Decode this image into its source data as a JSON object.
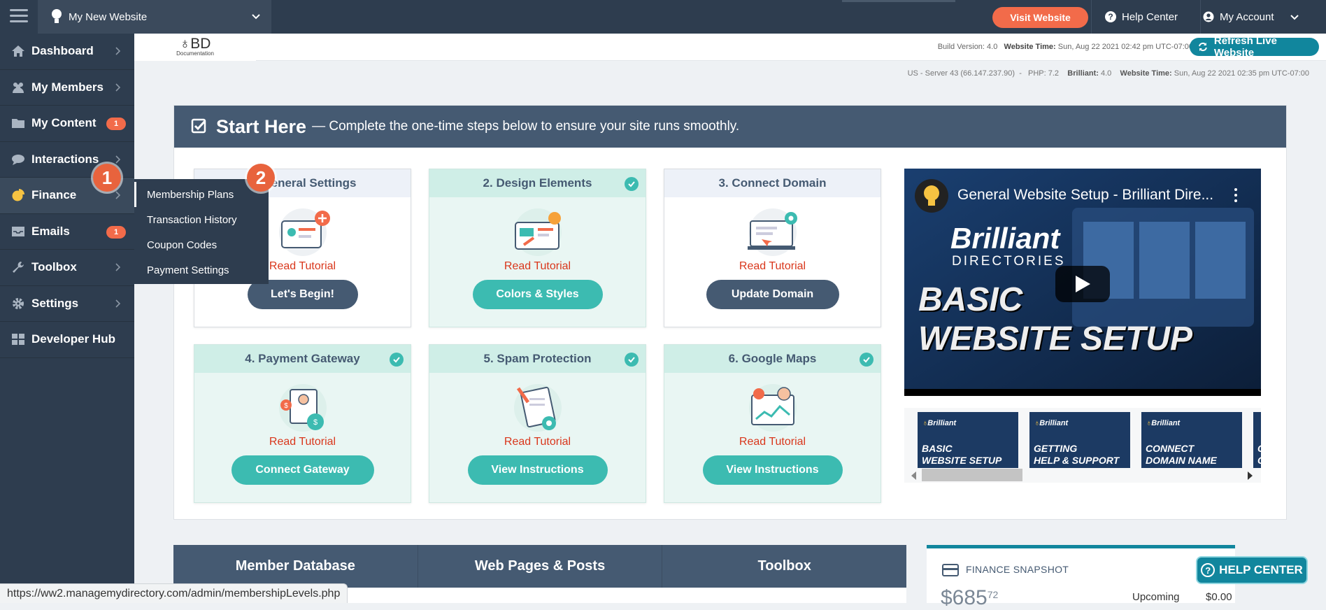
{
  "topbar": {
    "site_name": "My New Website",
    "visit_button": "Visit Website",
    "help_center": "Help Center",
    "my_account": "My Account"
  },
  "sidebar": {
    "items": [
      {
        "label": "Dashboard",
        "icon": "home-icon"
      },
      {
        "label": "My Members",
        "icon": "users-icon"
      },
      {
        "label": "My Content",
        "icon": "folder-icon",
        "badge": "1"
      },
      {
        "label": "Interactions",
        "icon": "chat-icon"
      },
      {
        "label": "Finance",
        "icon": "pie-chart-icon"
      },
      {
        "label": "Emails",
        "icon": "inbox-icon",
        "badge": "1"
      },
      {
        "label": "Toolbox",
        "icon": "wrench-icon"
      },
      {
        "label": "Settings",
        "icon": "gear-icon"
      },
      {
        "label": "Developer Hub",
        "icon": "grid-icon"
      }
    ]
  },
  "flyout": {
    "items": [
      "Membership Plans",
      "Transaction History",
      "Coupon Codes",
      "Payment Settings"
    ]
  },
  "annotations": {
    "step1": "1",
    "step2": "2"
  },
  "logo": {
    "mark": "BD",
    "sub": "Documentation"
  },
  "infobar": {
    "build_label": "Build Version:",
    "build_value": "4.0",
    "time_label": "Website Time:",
    "time_value": "Sun, Aug 22 2021 02:42 pm UTC-07:00",
    "refresh_button": "Refresh Live Website"
  },
  "server": {
    "server_value": "US - Server 43 (66.147.237.90)",
    "php": "PHP: 7.2",
    "brilliant_label": "Brilliant:",
    "brilliant_value": "4.0",
    "time_label": "Website Time:",
    "time_value": "Sun, Aug 22 2021 02:35 pm UTC-07:00"
  },
  "start": {
    "title": "Start Here",
    "subtitle": "— Complete the one-time steps below to ensure your site runs smoothly.",
    "cards": [
      {
        "title": "1. General Settings",
        "tutorial": "Read Tutorial",
        "button": "Let's Begin!",
        "done": false
      },
      {
        "title": "2. Design Elements",
        "tutorial": "Read Tutorial",
        "button": "Colors & Styles",
        "done": true
      },
      {
        "title": "3. Connect Domain",
        "tutorial": "Read Tutorial",
        "button": "Update Domain",
        "done": false
      },
      {
        "title": "4. Payment Gateway",
        "tutorial": "Read Tutorial",
        "button": "Connect Gateway",
        "done": true
      },
      {
        "title": "5. Spam Protection",
        "tutorial": "Read Tutorial",
        "button": "View Instructions",
        "done": true
      },
      {
        "title": "6. Google Maps",
        "tutorial": "Read Tutorial",
        "button": "View Instructions",
        "done": true
      }
    ]
  },
  "video": {
    "title": "General Website Setup - Brilliant Dire...",
    "brand": "Brilliant",
    "brand_sub": "DIRECTORIES",
    "headline_1": "BASIC",
    "headline_2": "WEBSITE SETUP",
    "thumbnails": [
      {
        "line1": "BASIC",
        "line2": "WEBSITE SETUP"
      },
      {
        "line1": "GETTING",
        "line2": "HELP & SUPPORT"
      },
      {
        "line1": "CONNECT",
        "line2": "DOMAIN NAME"
      },
      {
        "line1": "C",
        "line2": "C"
      }
    ]
  },
  "bottom_tabs": [
    "Member Database",
    "Web Pages & Posts",
    "Toolbox"
  ],
  "finance": {
    "title": "FINANCE SNAPSHOT",
    "amount_whole": "$685",
    "amount_cents": "72",
    "upcoming_label": "Upcoming",
    "upcoming_value": "$0.00"
  },
  "help_button": "HELP CENTER",
  "status_url": "https://ww2.managemydirectory.com/admin/membershipLevels.php",
  "colors": {
    "sidebar": "#2e3d4f",
    "accent": "#f26b4a",
    "teal": "#3cbbb1",
    "header": "#455a72",
    "refresh": "#11869d"
  }
}
